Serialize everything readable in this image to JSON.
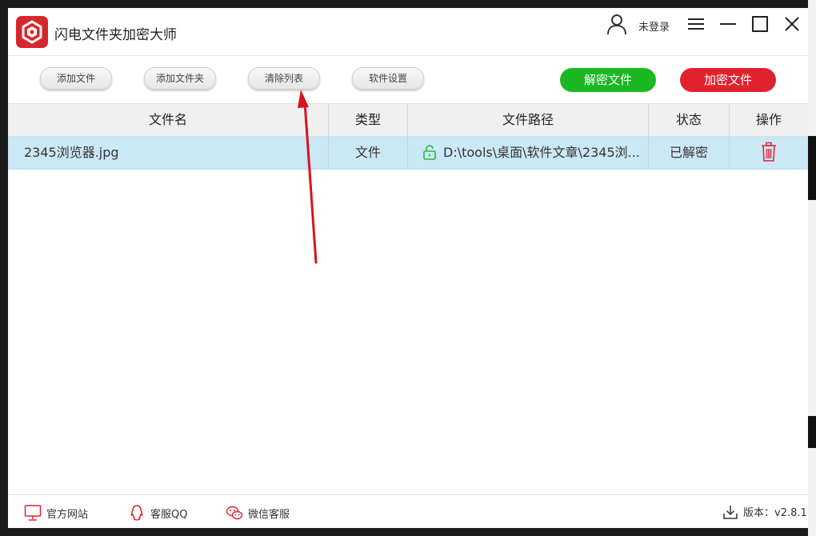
{
  "app": {
    "title": "闪电文件夹加密大师",
    "login_label": "未登录"
  },
  "toolbar": {
    "add_file": "添加文件",
    "add_folder": "添加文件夹",
    "clear_list": "清除列表",
    "settings": "软件设置",
    "decrypt": "解密文件",
    "encrypt": "加密文件"
  },
  "table": {
    "headers": [
      "文件名",
      "类型",
      "文件路径",
      "状态",
      "操作"
    ],
    "rows": [
      {
        "name": "2345浏览器.jpg",
        "type": "文件",
        "path": "D:\\tools\\桌面\\软件文章\\2345浏...",
        "status": "已解密",
        "lock": "unlocked-lock-icon",
        "action": "trash-icon"
      }
    ]
  },
  "footer": {
    "website": "官方网站",
    "qq": "客服QQ",
    "wechat": "微信客服",
    "version": "版本：v2.8.1"
  },
  "colors": {
    "accent_green": "#1cb823",
    "accent_red": "#e0232d",
    "brand": "#d9262c",
    "row_selected": "#cbe8f6",
    "annotation_arrow": "#d8141c"
  }
}
